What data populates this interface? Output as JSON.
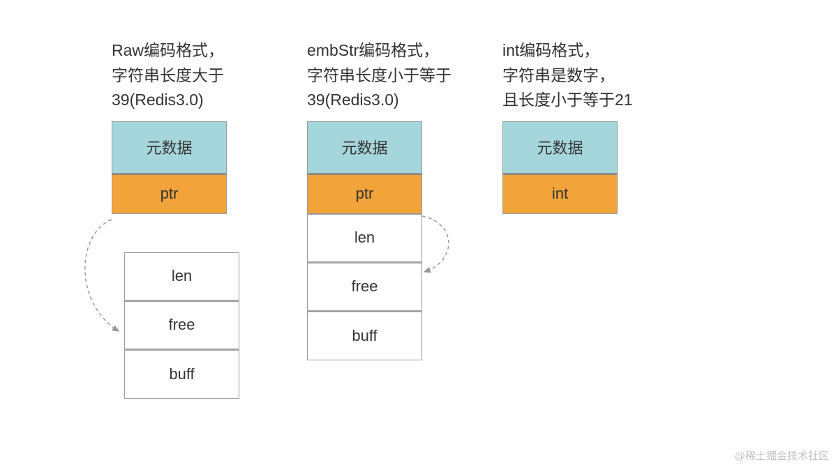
{
  "columns": {
    "raw": {
      "desc_line1": "Raw编码格式，",
      "desc_line2": "字符串长度大于",
      "desc_line3": "39(Redis3.0)",
      "meta": "元数据",
      "ptr": "ptr",
      "sds": {
        "len": "len",
        "free": "free",
        "buff": "buff"
      }
    },
    "embstr": {
      "desc_line1": "embStr编码格式，",
      "desc_line2": "字符串长度小于等于",
      "desc_line3": "39(Redis3.0)",
      "meta": "元数据",
      "ptr": "ptr",
      "sds": {
        "len": "len",
        "free": "free",
        "buff": "buff"
      }
    },
    "intenc": {
      "desc_line1": "int编码格式，",
      "desc_line2": "字符串是数字，",
      "desc_line3": "且长度小于等于21",
      "meta": "元数据",
      "ptr": "int"
    }
  },
  "colors": {
    "meta_bg": "#a5d6db",
    "ptr_bg": "#f2a33a",
    "border": "#999999"
  },
  "watermark": "@稀土掘金技术社区"
}
